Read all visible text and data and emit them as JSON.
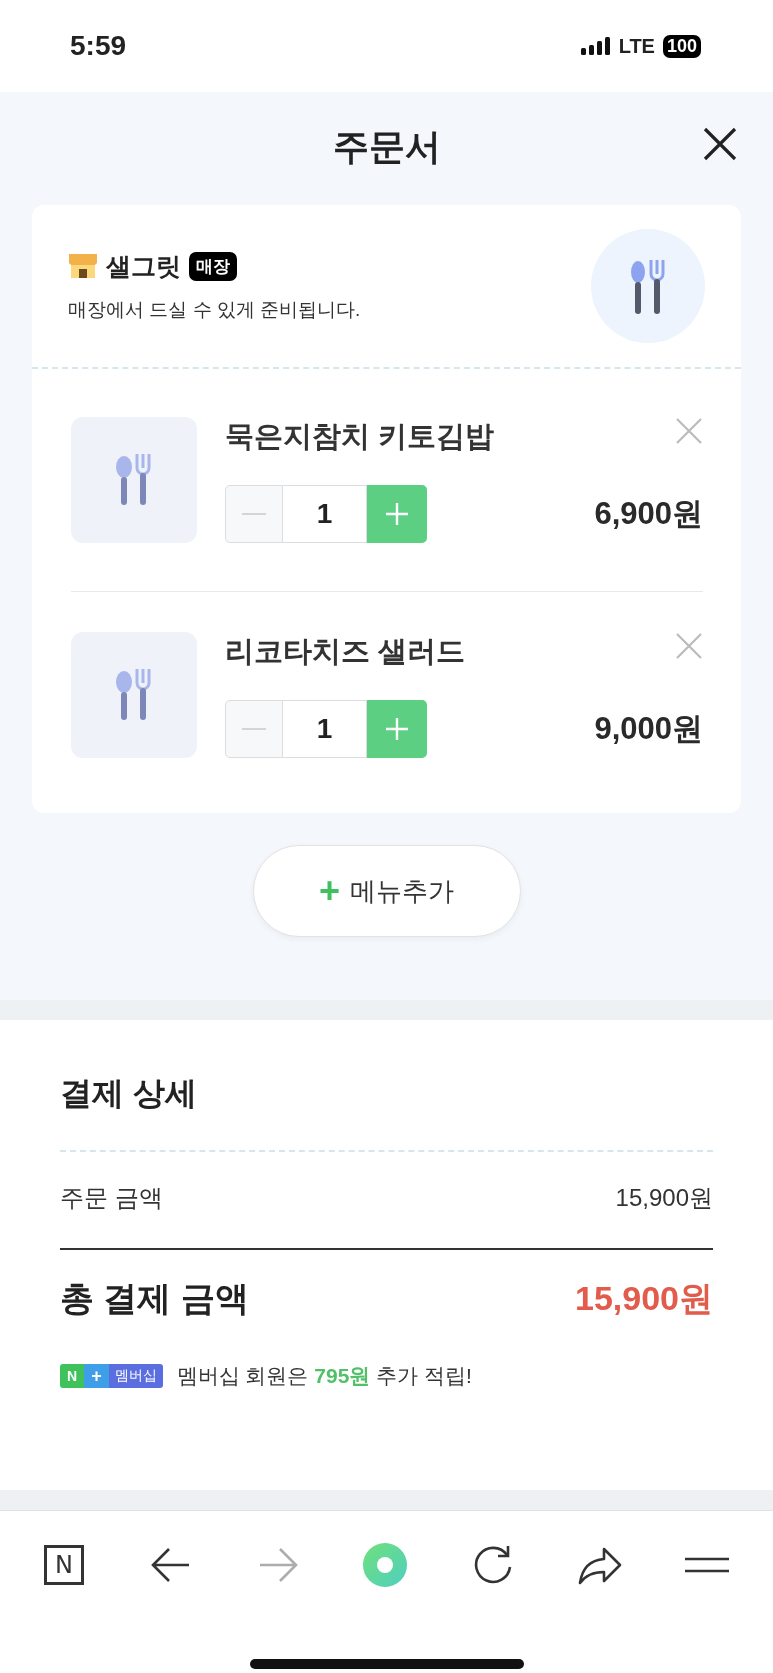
{
  "status_bar": {
    "time": "5:59",
    "network": "LTE",
    "battery": "100"
  },
  "header": {
    "title": "주문서"
  },
  "store": {
    "name": "샐그릿",
    "badge": "매장",
    "note": "매장에서 드실 수 있게 준비됩니다."
  },
  "items": [
    {
      "name": "묵은지참치 키토김밥",
      "quantity": "1",
      "price": "6,900원",
      "decrease_disabled": true
    },
    {
      "name": "리코타치즈 샐러드",
      "quantity": "1",
      "price": "9,000원",
      "decrease_disabled": true
    }
  ],
  "add_menu": {
    "icon": "+",
    "label": "메뉴추가"
  },
  "payment": {
    "title": "결제 상세",
    "order_label": "주문 금액",
    "order_amount": "15,900원",
    "total_label": "총 결제 금액",
    "total_amount": "15,900원"
  },
  "membership": {
    "badge_n": "N",
    "badge_plus": "+",
    "badge_label": "멤버십",
    "message": "멤버십 회원은 **795원** 추가 적립!"
  },
  "nav_bar": [
    {
      "kind": "naver",
      "label": "N",
      "disabled": false
    },
    {
      "kind": "back",
      "disabled": false
    },
    {
      "kind": "forward",
      "disabled": true
    },
    {
      "kind": "home",
      "disabled": false
    },
    {
      "kind": "reload",
      "disabled": false
    },
    {
      "kind": "share",
      "disabled": false
    },
    {
      "kind": "menu",
      "disabled": false
    }
  ]
}
